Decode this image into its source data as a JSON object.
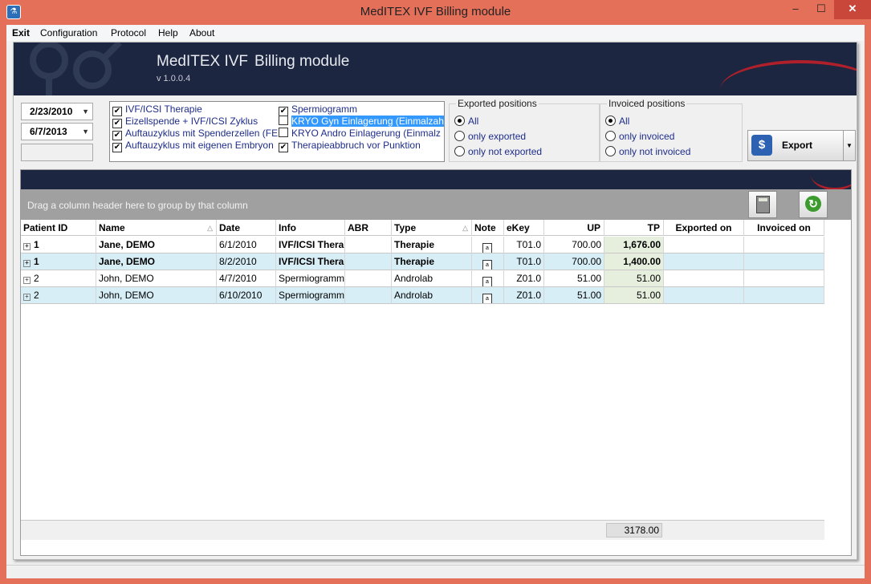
{
  "window": {
    "title": "MedITEX IVF Billing module",
    "minimize": "–",
    "maximize": "☐",
    "close": "✕"
  },
  "menu": [
    "Exit",
    "Configuration",
    "Protocol",
    "Help",
    "About"
  ],
  "banner": {
    "title": "MedITEX IVF",
    "subtitle": "Billing module",
    "version": "v 1.0.0.4"
  },
  "filters": {
    "date_from": "2/23/2010",
    "date_to": "6/7/2013",
    "checkboxes_left": [
      {
        "label": "IVF/ICSI Therapie",
        "checked": true
      },
      {
        "label": "Eizellspende + IVF/ICSI Zyklus",
        "checked": true
      },
      {
        "label": "Auftauzyklus mit Spenderzellen (FE",
        "checked": true
      },
      {
        "label": "Auftauzyklus mit eigenen Embryon",
        "checked": true
      }
    ],
    "checkboxes_right": [
      {
        "label": "Spermiogramm",
        "checked": true
      },
      {
        "label": "KRYO Gyn Einlagerung (Einmalzah",
        "checked": false,
        "selected": true
      },
      {
        "label": "KRYO Andro Einlagerung (Einmalz",
        "checked": false
      },
      {
        "label": "Therapieabbruch vor Punktion",
        "checked": true
      }
    ]
  },
  "exported_positions": {
    "title": "Exported positions",
    "options": [
      "All",
      "only exported",
      "only not exported"
    ],
    "selected": 0
  },
  "invoiced_positions": {
    "title": "Invoiced positions",
    "options": [
      "All",
      "only invoiced",
      "only not invoiced"
    ],
    "selected": 0
  },
  "export_button": {
    "label": "Export",
    "icon": "money-bag-icon"
  },
  "grid": {
    "group_hint": "Drag a column header here to group by that column",
    "columns": [
      "Patient ID",
      "Name",
      "Date",
      "Info",
      "ABR",
      "Type",
      "Note",
      "eKey",
      "UP",
      "TP",
      "Exported on",
      "Invoiced on"
    ],
    "rows": [
      {
        "patient_id": "1",
        "name": "Jane, DEMO",
        "date": "6/1/2010",
        "info": "IVF/ICSI Therapie",
        "abr": "",
        "type": "Therapie",
        "ekey": "T01.0",
        "up": "700.00",
        "tp": "1,676.00",
        "exported_on": "",
        "invoiced_on": "",
        "bold": true
      },
      {
        "patient_id": "1",
        "name": "Jane, DEMO",
        "date": "8/2/2010",
        "info": "IVF/ICSI Therapie",
        "abr": "",
        "type": "Therapie",
        "ekey": "T01.0",
        "up": "700.00",
        "tp": "1,400.00",
        "exported_on": "",
        "invoiced_on": "",
        "bold": true
      },
      {
        "patient_id": "2",
        "name": "John, DEMO",
        "date": "4/7/2010",
        "info": "Spermiogramm",
        "abr": "",
        "type": "Androlab",
        "ekey": "Z01.0",
        "up": "51.00",
        "tp": "51.00",
        "exported_on": "",
        "invoiced_on": "",
        "bold": false
      },
      {
        "patient_id": "2",
        "name": "John, DEMO",
        "date": "6/10/2010",
        "info": "Spermiogramm",
        "abr": "",
        "type": "Androlab",
        "ekey": "Z01.0",
        "up": "51.00",
        "tp": "51.00",
        "exported_on": "",
        "invoiced_on": "",
        "bold": false
      }
    ],
    "total": "3178.00"
  }
}
